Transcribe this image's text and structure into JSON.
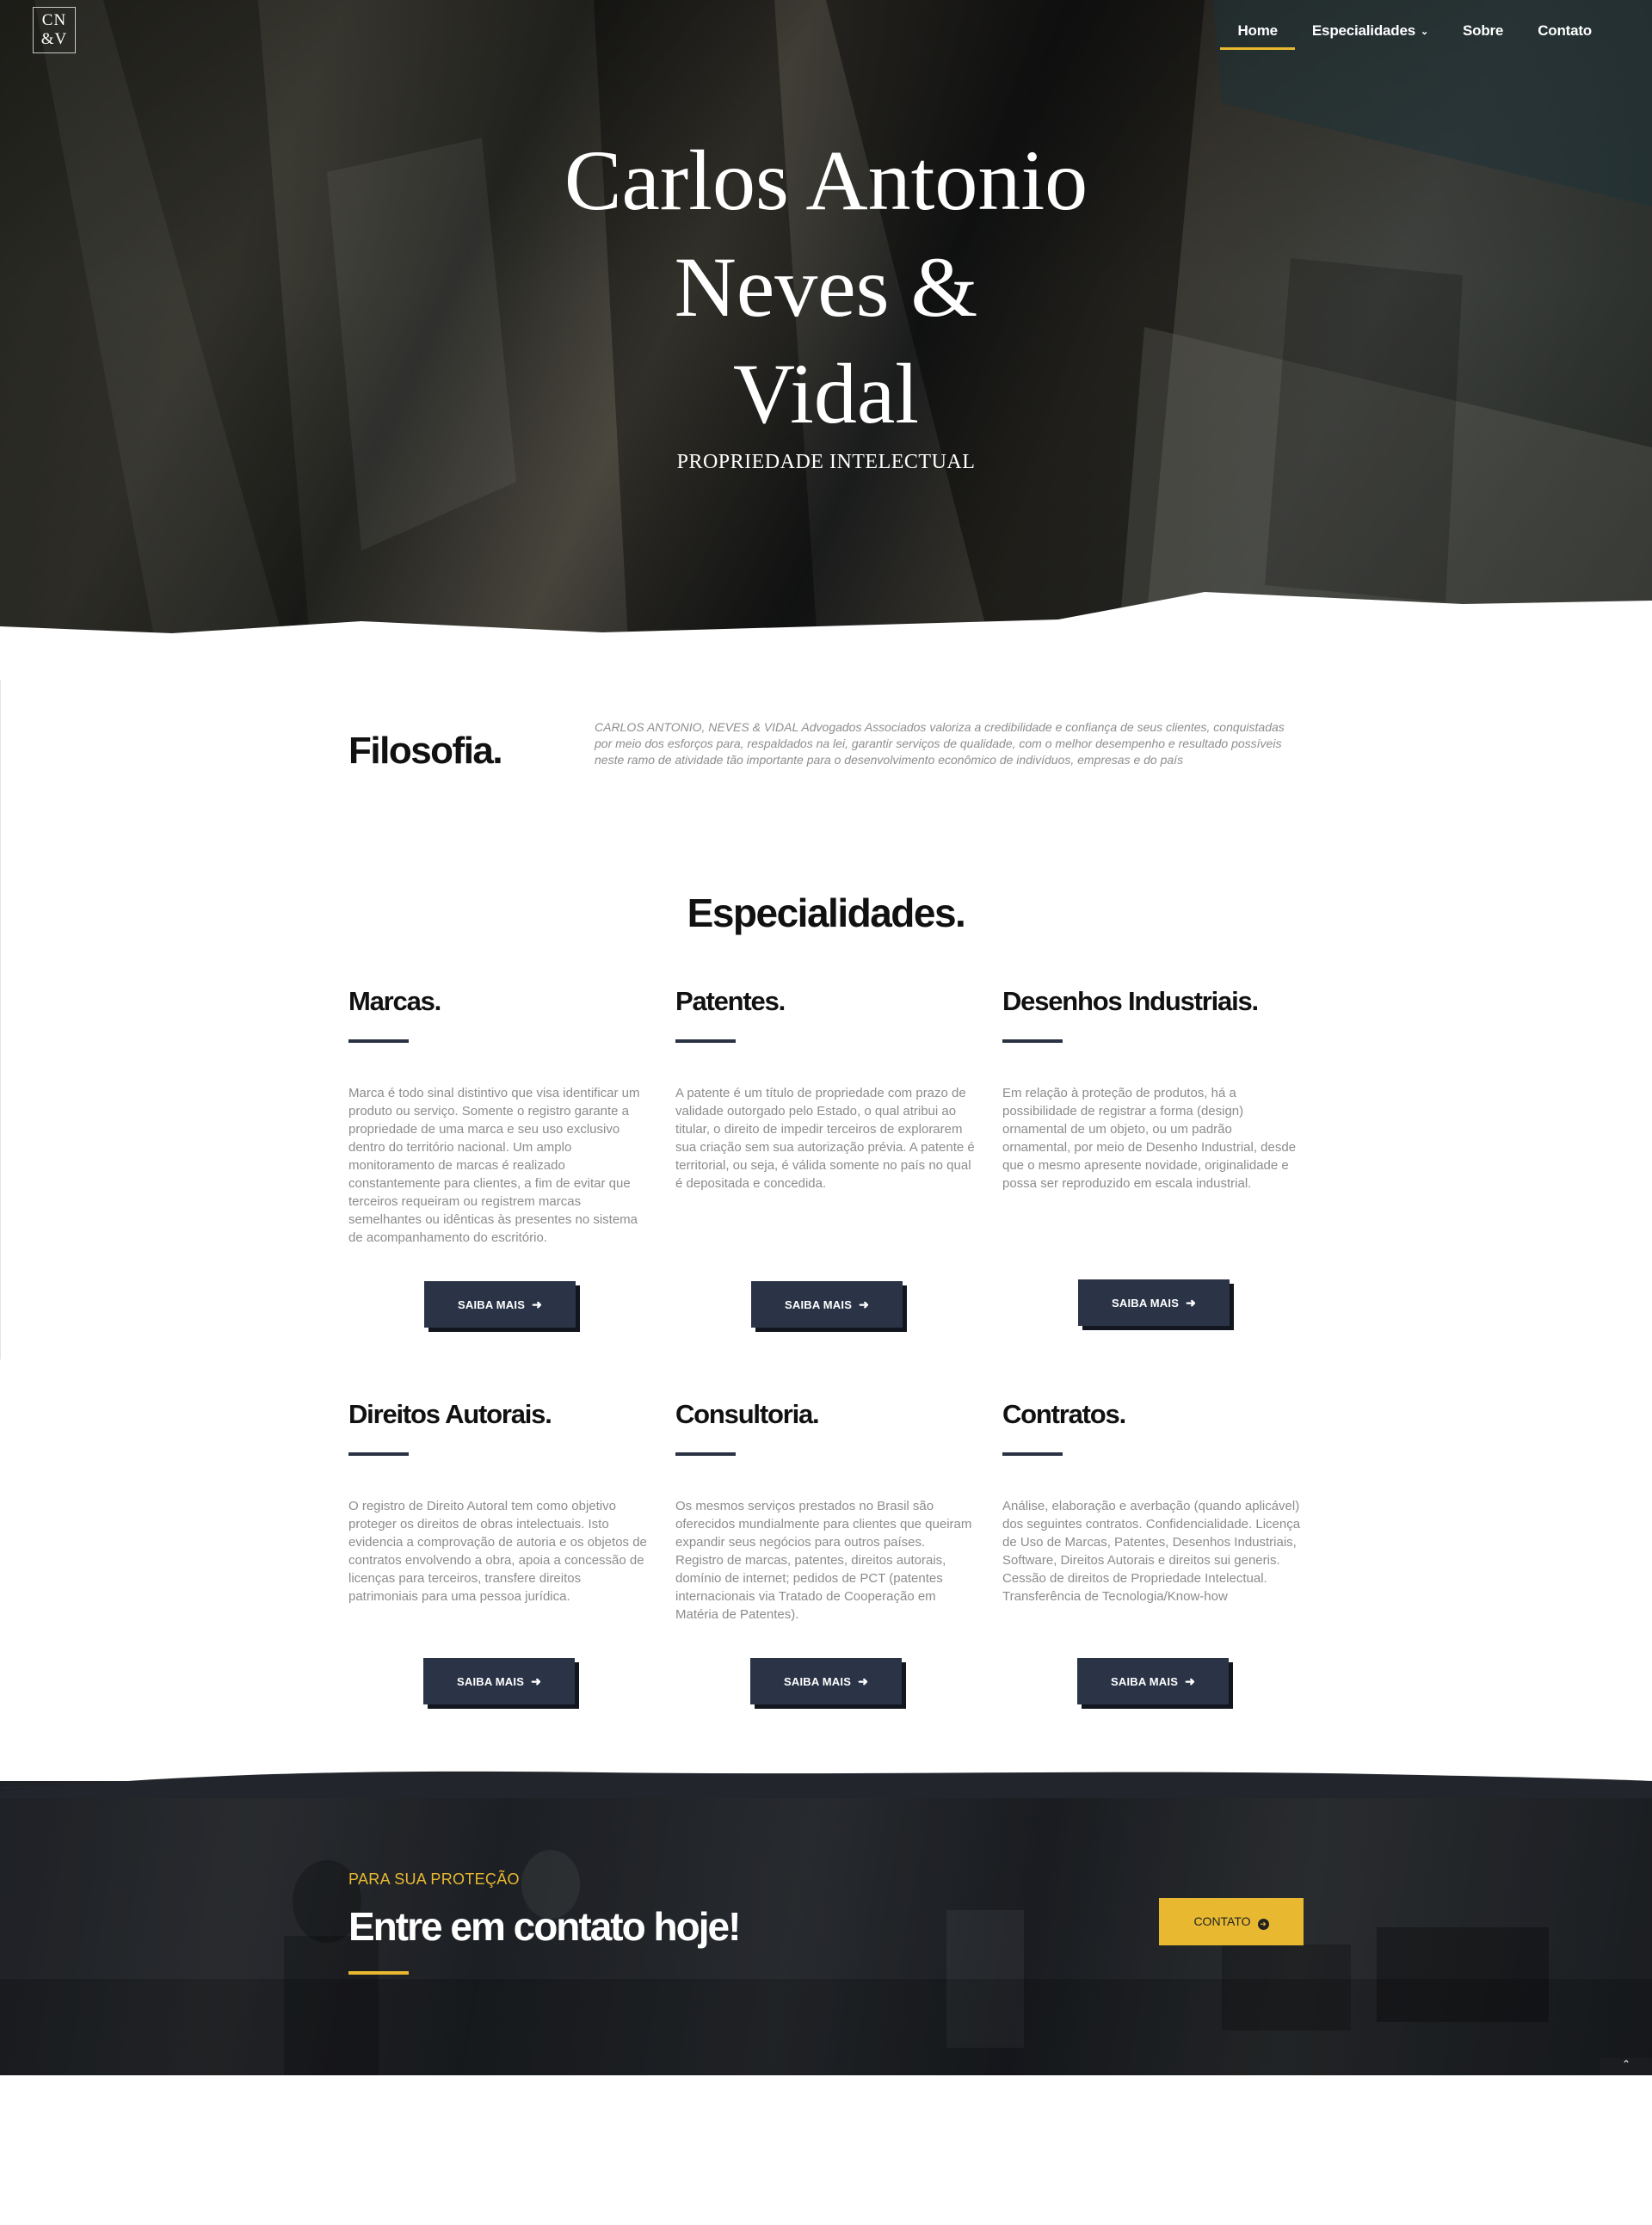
{
  "logo": {
    "line1": "CN",
    "line2": "&V"
  },
  "nav": {
    "items": [
      {
        "label": "Home"
      },
      {
        "label": "Especialidades"
      },
      {
        "label": "Sobre"
      },
      {
        "label": "Contato"
      }
    ],
    "active": "Home"
  },
  "hero": {
    "title": "Carlos Antonio\nNeves &\nVidal",
    "subtitle": "PROPRIEDADE INTELECTUAL"
  },
  "filosofia": {
    "title": "Filosofia.",
    "text": "CARLOS ANTONIO, NEVES & VIDAL Advogados Associados valoriza a credibilidade e confiança de seus clientes, conquistadas por meio dos esforços para, respaldados na lei, garantir serviços de qualidade, com o melhor desempenho e resultado possíveis neste ramo de atividade tão importante para o desenvolvimento econômico de indivíduos, empresas e do país"
  },
  "especialidades": {
    "title": "Especialidades.",
    "button_label": "SAIBA MAIS",
    "cards": [
      {
        "title": "Marcas.",
        "text": "Marca é todo sinal distintivo que visa identificar um produto ou serviço. Somente o registro garante a propriedade de uma marca e seu uso exclusivo dentro do território nacional. Um amplo monitoramento de marcas é realizado constantemente para clientes, a fim de evitar que terceiros requeiram ou registrem marcas semelhantes ou idênticas às presentes no sistema de acompanhamento do escritório."
      },
      {
        "title": "Patentes.",
        "text": "A patente é um título de propriedade com prazo de validade outorgado pelo Estado, o qual atribui ao titular, o direito de impedir terceiros de explorarem sua criação sem sua autorização prévia. A patente é territorial, ou seja, é válida somente no país no qual é depositada e concedida."
      },
      {
        "title": "Desenhos Industriais.",
        "text": "Em relação à proteção de produtos, há a possibilidade de registrar a forma (design) ornamental de um objeto, ou um padrão ornamental, por meio de Desenho Industrial, desde que o mesmo apresente novidade, originalidade e possa ser reproduzido em escala industrial."
      },
      {
        "title": "Direitos Autorais.",
        "text": "O registro de Direito Autoral tem como objetivo proteger os direitos de obras intelectuais. Isto evidencia a comprovação de autoria e os objetos de contratos envolvendo a obra, apoia a concessão de licenças para terceiros, transfere direitos patrimoniais para uma pessoa jurídica."
      },
      {
        "title": "Consultoria.",
        "text": "Os mesmos serviços prestados no Brasil são oferecidos mundialmente para clientes que queiram expandir seus negócios para outros países. Registro de marcas, patentes, direitos autorais, domínio de internet; pedidos de PCT (patentes internacionais via Tratado de Cooperação em Matéria de Patentes)."
      },
      {
        "title": "Contratos.",
        "text": "Análise, elaboração e averbação (quando aplicável) dos seguintes contratos. Confidencialidade. Licença de Uso de Marcas, Patentes, Desenhos Industriais, Software, Direitos Autorais e direitos sui generis. Cessão de direitos de Propriedade Intelectual. Transferência de Tecnologia/Know-how"
      }
    ]
  },
  "cta": {
    "kicker": "PARA SUA PROTEÇÃO",
    "title": "Entre em contato hoje!",
    "button_label": "CONTATO"
  },
  "icons": {
    "nav_dropdown": "chevron-down-icon",
    "button_arrow": "arrow-right-icon",
    "cta_arrow": "circle-arrow-right-icon"
  },
  "colors": {
    "accent": "#e8b930",
    "button": "#2b3447",
    "heading": "#111111",
    "body_text": "#8c8c8c"
  }
}
